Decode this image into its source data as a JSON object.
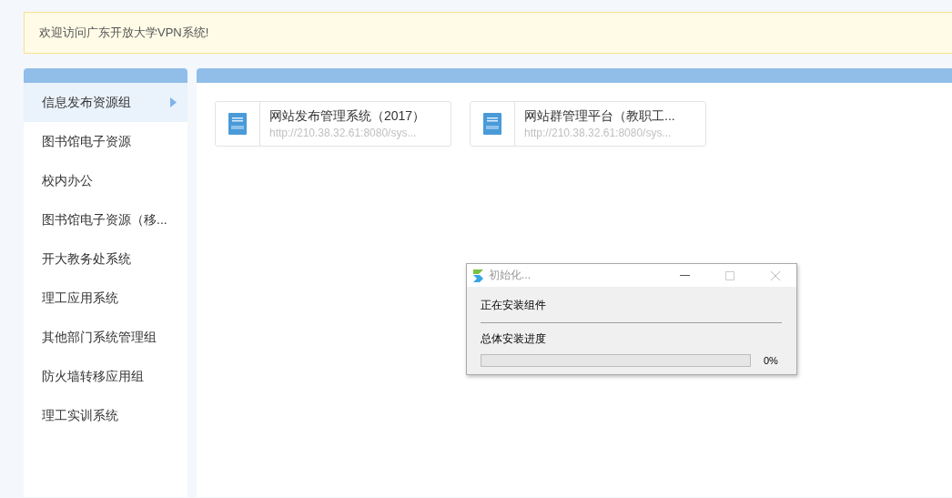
{
  "banner": {
    "text": "欢迎访问广东开放大学VPN系统!"
  },
  "sidebar": {
    "items": [
      {
        "label": "信息发布资源组",
        "selected": true
      },
      {
        "label": "图书馆电子资源",
        "selected": false
      },
      {
        "label": "校内办公",
        "selected": false
      },
      {
        "label": "图书馆电子资源（移...",
        "selected": false
      },
      {
        "label": "开大教务处系统",
        "selected": false
      },
      {
        "label": "理工应用系统",
        "selected": false
      },
      {
        "label": "其他部门系统管理组",
        "selected": false
      },
      {
        "label": "防火墙转移应用组",
        "selected": false
      },
      {
        "label": "理工实训系统",
        "selected": false
      }
    ]
  },
  "resources": [
    {
      "title": "网站发布管理系统（2017）",
      "url": "http://210.38.32.61:8080/sys..."
    },
    {
      "title": "网站群管理平台（教职工...",
      "url": "http://210.38.32.61:8080/sys..."
    }
  ],
  "dialog": {
    "title": "初始化...",
    "status": "正在安装组件",
    "progress_label": "总体安装进度",
    "level": 0,
    "reading": "0%"
  }
}
